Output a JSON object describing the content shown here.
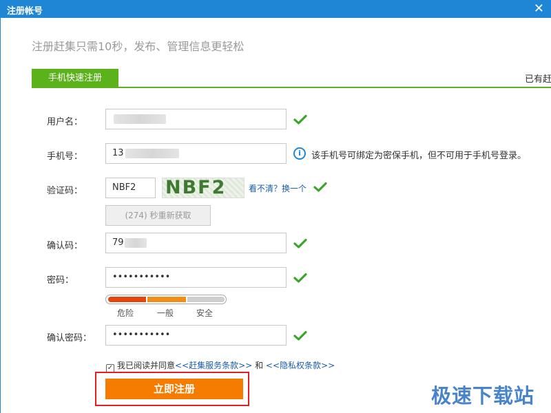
{
  "window": {
    "title": "注册帐号",
    "close_glyph": "✕"
  },
  "subtitle": "注册赶集只需10秒，发布、管理信息更轻松",
  "tabs": {
    "mobile_register": "手机快速注册",
    "existing_account": "已有赶"
  },
  "form": {
    "username": {
      "label": "用户名：",
      "value": ""
    },
    "phone": {
      "label": "手机号：",
      "value_prefix": "13",
      "hint": "该手机号可绑定为密保手机，但不可用于手机号登录。"
    },
    "captcha": {
      "label": "验证码：",
      "value": "NBF2",
      "image_text": "NBF2",
      "refresh_label": "看不清？换一个"
    },
    "resend_label": "(274) 秒重新获取",
    "confirm_code": {
      "label": "确认码：",
      "value_prefix": "79"
    },
    "password": {
      "label": "密码：",
      "value": "•••••••••••"
    },
    "strength": {
      "weak": "危险",
      "medium": "一般",
      "strong": "安全",
      "level": 0.67
    },
    "confirm_password": {
      "label": "确认密码：",
      "value": "•••••••••••"
    },
    "agree": {
      "checked": true,
      "text_prefix": "我已阅读并同意",
      "terms_link": "<<赶集服务条款>>",
      "and": "和",
      "privacy_link": "<<隐私权条款>>"
    },
    "submit_label": "立即注册"
  },
  "watermark": "极速下载站",
  "colors": {
    "title_bar": "#1f86d6",
    "tab_green": "#5cb21b",
    "check_green": "#3aa52b",
    "submit_orange": "#f57c00",
    "highlight_red": "#e02020"
  }
}
